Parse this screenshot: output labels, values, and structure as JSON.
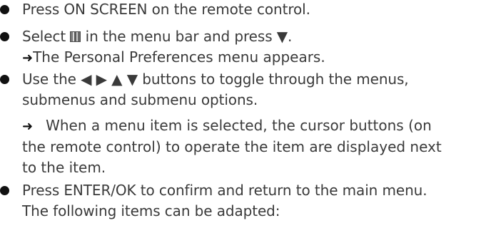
{
  "steps": [
    {
      "text": "Press ON SCREEN on the remote control."
    },
    {
      "text_before_icon": "Select ",
      "icon": "picture-menu-icon",
      "text_after_icon": " in the menu bar and press ▼.",
      "result_arrow": "➜",
      "result_text": "The Personal Preferences menu appears."
    },
    {
      "line1": "Use the ◀ ▶ ▲ ▼ buttons to toggle through the menus,",
      "line2": "submenus and submenu options.",
      "result_arrow": "➜",
      "result_line1": "When a menu item is selected, the cursor buttons (on",
      "result_line2": "the remote control) to operate the item are displayed next",
      "result_line3": "to the item."
    },
    {
      "line1": "Press ENTER/OK to confirm and return to the main menu.",
      "line2": "The following items can be adapted:"
    }
  ]
}
